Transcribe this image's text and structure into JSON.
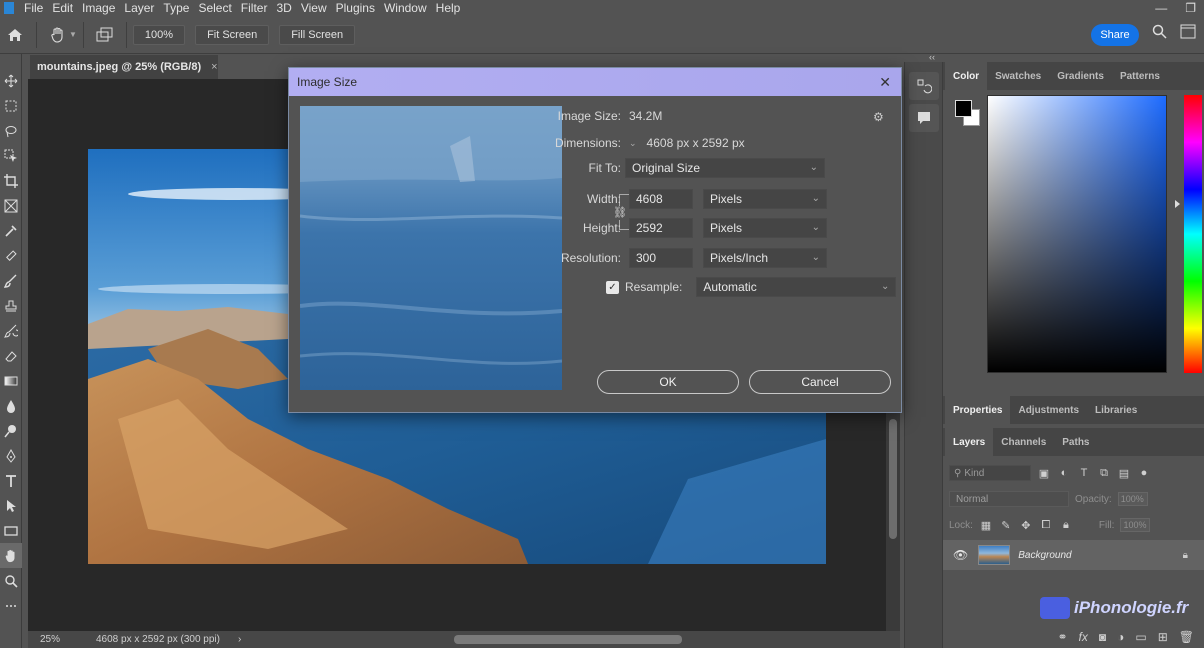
{
  "menubar": {
    "items": [
      "File",
      "Edit",
      "Image",
      "Layer",
      "Type",
      "Select",
      "Filter",
      "3D",
      "View",
      "Plugins",
      "Window",
      "Help"
    ]
  },
  "optionsbar": {
    "zoom_label": "100%",
    "fit_screen_label": "Fit Screen",
    "fill_screen_label": "Fill Screen",
    "share_label": "Share"
  },
  "document": {
    "tab_title": "mountains.jpeg @ 25% (RGB/8)",
    "tab_close": "×",
    "zoom": "25%",
    "status": "4608 px x 2592 px (300 ppi)",
    "status_arrow": "›"
  },
  "dialog": {
    "title": "Image Size",
    "close": "✕",
    "image_size_label": "Image Size:",
    "image_size_value": "34.2M",
    "dimensions_label": "Dimensions:",
    "dimensions_value": "4608 px  x  2592 px",
    "fit_to_label": "Fit To:",
    "fit_to_value": "Original Size",
    "width_label": "Width:",
    "width_value": "4608",
    "width_unit": "Pixels",
    "height_label": "Height:",
    "height_value": "2592",
    "height_unit": "Pixels",
    "resolution_label": "Resolution:",
    "resolution_value": "300",
    "resolution_unit": "Pixels/Inch",
    "resample_label": "Resample:",
    "resample_value": "Automatic",
    "resample_checked": true,
    "ok_label": "OK",
    "cancel_label": "Cancel"
  },
  "color_panel": {
    "tabs": [
      "Color",
      "Swatches",
      "Gradients",
      "Patterns"
    ],
    "foreground": "#000000",
    "background": "#ffffff"
  },
  "properties_panel": {
    "tabs": [
      "Properties",
      "Adjustments",
      "Libraries"
    ]
  },
  "layers_panel": {
    "tabs": [
      "Layers",
      "Channels",
      "Paths"
    ],
    "kind_placeholder": "Kind",
    "blend_mode": "Normal",
    "opacity_label": "Opacity:",
    "opacity_value": "100%",
    "lock_label": "Lock:",
    "fill_label": "Fill:",
    "fill_value": "100%",
    "layers": [
      {
        "name": "Background",
        "visible": true,
        "locked": true
      }
    ]
  },
  "watermark": {
    "text": "iPhonologie.fr"
  },
  "colors": {
    "accent": "#1473e6",
    "dialog_title_bar": "#b2aef2"
  }
}
